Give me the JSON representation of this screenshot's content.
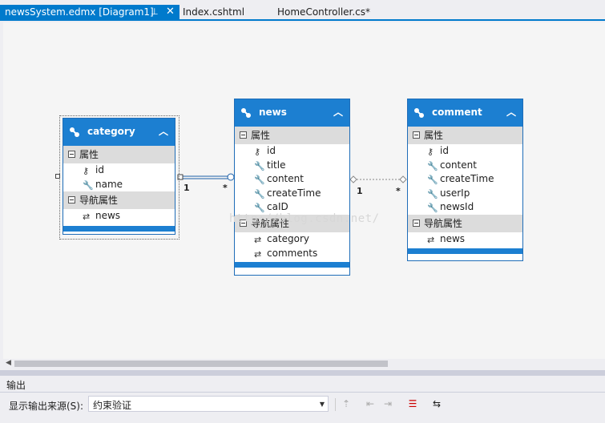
{
  "tabs": [
    {
      "label": "newsSystem.edmx [Diagram1]",
      "pin_icon": "pin-icon",
      "close_icon": "close-icon"
    },
    {
      "label": "Index.cshtml"
    },
    {
      "label": "HomeController.cs*"
    }
  ],
  "watermark": "http://blog.csdn.net/",
  "entities": {
    "category": {
      "title": "category",
      "prop_section": "属性",
      "props": [
        "id",
        "name"
      ],
      "nav_section": "导航属性",
      "navs": [
        "news"
      ]
    },
    "news": {
      "title": "news",
      "prop_section": "属性",
      "props": [
        "id",
        "title",
        "content",
        "createTime",
        "caID"
      ],
      "nav_section": "导航属性",
      "navs": [
        "category",
        "comments"
      ]
    },
    "comment": {
      "title": "comment",
      "prop_section": "属性",
      "props": [
        "id",
        "content",
        "createTime",
        "userIp",
        "newsId"
      ],
      "nav_section": "导航属性",
      "navs": [
        "news"
      ]
    }
  },
  "associations": [
    {
      "from": "category",
      "to": "news",
      "from_mult": "1",
      "to_mult": "*"
    },
    {
      "from": "news",
      "to": "comment",
      "from_mult": "1",
      "to_mult": "*"
    }
  ],
  "output": {
    "title": "输出",
    "source_label": "显示输出来源(S):",
    "source_value": "约束验证"
  },
  "colors": {
    "accent": "#007acc",
    "entity_header": "#1c7fd1"
  }
}
